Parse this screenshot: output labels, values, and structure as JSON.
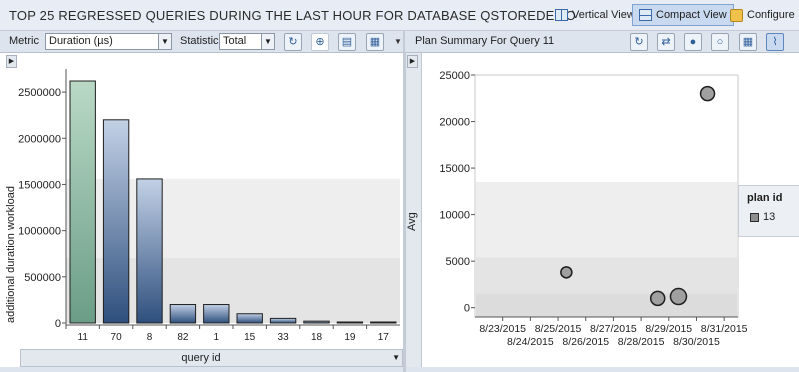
{
  "header": {
    "title": "TOP 25 REGRESSED QUERIES DURING THE LAST HOUR FOR DATABASE QSTOREDEMO",
    "buttons": [
      {
        "label": "Vertical View",
        "icon": "vertical-view-icon",
        "active": false
      },
      {
        "label": "Compact View",
        "icon": "compact-view-icon",
        "active": true
      },
      {
        "label": "Configure",
        "icon": "configure-icon",
        "active": false
      }
    ]
  },
  "left_toolbar": {
    "metric_label": "Metric",
    "metric_value": "Duration (µs)",
    "statistic_label": "Statistic",
    "statistic_value": "Total",
    "icons": [
      "refresh-icon",
      "target-icon",
      "window-icon",
      "layout-icon"
    ]
  },
  "right_toolbar": {
    "title": "Plan Summary For Query 11",
    "icons": [
      "refresh-icon",
      "compare-plans-icon",
      "force-plan-icon",
      "unforce-plan-icon",
      "grid-view-icon",
      "chart-view-icon"
    ]
  },
  "colors": {
    "bar_green_top": "#b9d9c6",
    "bar_green_bottom": "#6b9d86",
    "bar_blue_top": "#c3d1e6",
    "bar_blue_bottom": "#2e4f7d",
    "band_light": "#eeeeee",
    "band_mid": "#e4e4e4",
    "marker_fill": "#a0a0a0"
  },
  "chart_data": [
    {
      "type": "bar",
      "title": "",
      "xlabel": "query id",
      "ylabel": "additional duration workload",
      "ylim": [
        0,
        2750000
      ],
      "yticks": [
        "0",
        "500000",
        "1000000",
        "1500000",
        "2000000",
        "2500000"
      ],
      "ytick_values": [
        0,
        500000,
        1000000,
        1500000,
        2000000,
        2500000
      ],
      "categories": [
        "11",
        "70",
        "8",
        "82",
        "1",
        "15",
        "33",
        "18",
        "19",
        "17"
      ],
      "values": [
        2620000,
        2200000,
        1560000,
        200000,
        200000,
        100000,
        50000,
        20000,
        5000,
        2000
      ],
      "selected_index": 0,
      "grid": false
    },
    {
      "type": "scatter",
      "title": "",
      "xlabel": "",
      "ylabel": "Avg",
      "xlim": [
        "8/22/2015",
        "8/31/2015"
      ],
      "ylim": [
        -1000,
        25000
      ],
      "yticks": [
        "0",
        "5000",
        "10000",
        "15000",
        "20000",
        "25000"
      ],
      "ytick_values": [
        0,
        5000,
        10000,
        15000,
        20000,
        25000
      ],
      "xticks_upper": [
        "8/23/2015",
        "8/25/2015",
        "8/27/2015",
        "8/29/2015",
        "8/31/2015"
      ],
      "xticks_lower": [
        "8/24/2015",
        "8/26/2015",
        "8/28/2015",
        "8/30/2015"
      ],
      "xticks_upper_days": [
        23,
        25,
        27,
        29,
        31
      ],
      "xticks_lower_days": [
        24,
        26,
        28,
        30
      ],
      "legend_title": "plan id",
      "legend_position": "right",
      "series": [
        {
          "name": "13",
          "points": [
            {
              "x_day": 25.3,
              "y": 3800,
              "size": "small"
            },
            {
              "x_day": 28.6,
              "y": 1000,
              "size": "medium"
            },
            {
              "x_day": 29.35,
              "y": 1200,
              "size": "large"
            },
            {
              "x_day": 30.4,
              "y": 23000,
              "size": "medium"
            }
          ]
        }
      ]
    }
  ]
}
